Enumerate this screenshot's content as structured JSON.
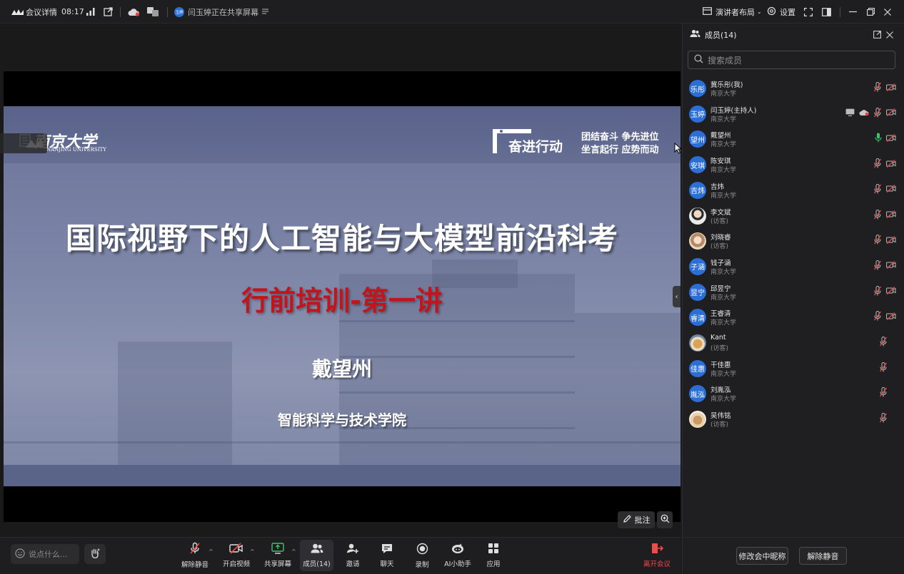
{
  "topbar": {
    "meeting_details": "会议详情",
    "time": "08:17",
    "sharing_badge": "玉婷",
    "sharing_status": "闫玉婷正在共享屏幕",
    "layout_label": "演讲者布局",
    "settings_label": "设置"
  },
  "slide": {
    "university_cn": "南京大学",
    "university_en": "NANJING UNIVERSITY",
    "action_title": "奋进行动",
    "slogan_line1": "团结奋斗 争先进位",
    "slogan_line2": "坐言起行 应势而动",
    "title": "国际视野下的人工智能与大模型前沿科考",
    "subtitle": "行前培训-第一讲",
    "presenter": "戴望州",
    "school": "智能科学与技术学院"
  },
  "stage": {
    "annotate_label": "批注"
  },
  "toolbar": {
    "chat_placeholder": "说点什么...",
    "unmute": "解除静音",
    "start_video": "开启视频",
    "share_screen": "共享屏幕",
    "members": "成员(14)",
    "invite": "邀请",
    "chat": "聊天",
    "record": "录制",
    "ai_assistant": "AI小助手",
    "apps": "应用",
    "leave": "离开会议"
  },
  "panel": {
    "title": "成员(14)",
    "search_placeholder": "搜索成员",
    "members": [
      {
        "avatar": "乐彤",
        "name": "冀乐彤(我)",
        "sub": "南京大学",
        "mic": "muted",
        "screen": false,
        "cloud": false
      },
      {
        "avatar": "玉婷",
        "name": "闫玉婷(主持人)",
        "sub": "南京大学",
        "mic": "muted",
        "screen": true,
        "cloud": true
      },
      {
        "avatar": "望州",
        "name": "戴望州",
        "sub": "南京大学",
        "mic": "active",
        "screen": false,
        "cloud": false
      },
      {
        "avatar": "安琪",
        "name": "陈安琪",
        "sub": "南京大学",
        "mic": "muted",
        "screen": false,
        "cloud": false
      },
      {
        "avatar": "吉炜",
        "name": "吉炜",
        "sub": "南京大学",
        "mic": "muted",
        "screen": false,
        "cloud": false
      },
      {
        "avatar": "",
        "name": "李文斌",
        "sub": "(访客)",
        "mic": "muted",
        "screen": false,
        "cloud": false
      },
      {
        "avatar": "",
        "name": "刘晓睿",
        "sub": "(访客)",
        "mic": "muted",
        "screen": false,
        "cloud": false
      },
      {
        "avatar": "子涵",
        "name": "钱子涵",
        "sub": "南京大学",
        "mic": "muted",
        "screen": false,
        "cloud": false
      },
      {
        "avatar": "昱宁",
        "name": "邱昱宁",
        "sub": "南京大学",
        "mic": "muted",
        "screen": false,
        "cloud": false
      },
      {
        "avatar": "睿清",
        "name": "王睿清",
        "sub": "南京大学",
        "mic": "muted",
        "screen": false,
        "cloud": false
      },
      {
        "avatar": "",
        "name": "Kant",
        "sub": "(访客)",
        "mic": "muted-only",
        "screen": false,
        "cloud": false
      },
      {
        "avatar": "佳惠",
        "name": "干佳惠",
        "sub": "南京大学",
        "mic": "muted-only",
        "screen": false,
        "cloud": false
      },
      {
        "avatar": "胤泓",
        "name": "刘胤泓",
        "sub": "南京大学",
        "mic": "muted-only",
        "screen": false,
        "cloud": false
      },
      {
        "avatar": "",
        "name": "吴伟铭",
        "sub": "(访客)",
        "mic": "muted-only",
        "screen": false,
        "cloud": false
      }
    ],
    "rename_button": "修改会中昵称",
    "unmute_all_button": "解除静音"
  },
  "colors": {
    "avatar_blue": "#2b6fd6",
    "leave_red": "#f04a4a",
    "subtitle_red": "#c3141c",
    "mic_active_green": "#3ec46d"
  }
}
